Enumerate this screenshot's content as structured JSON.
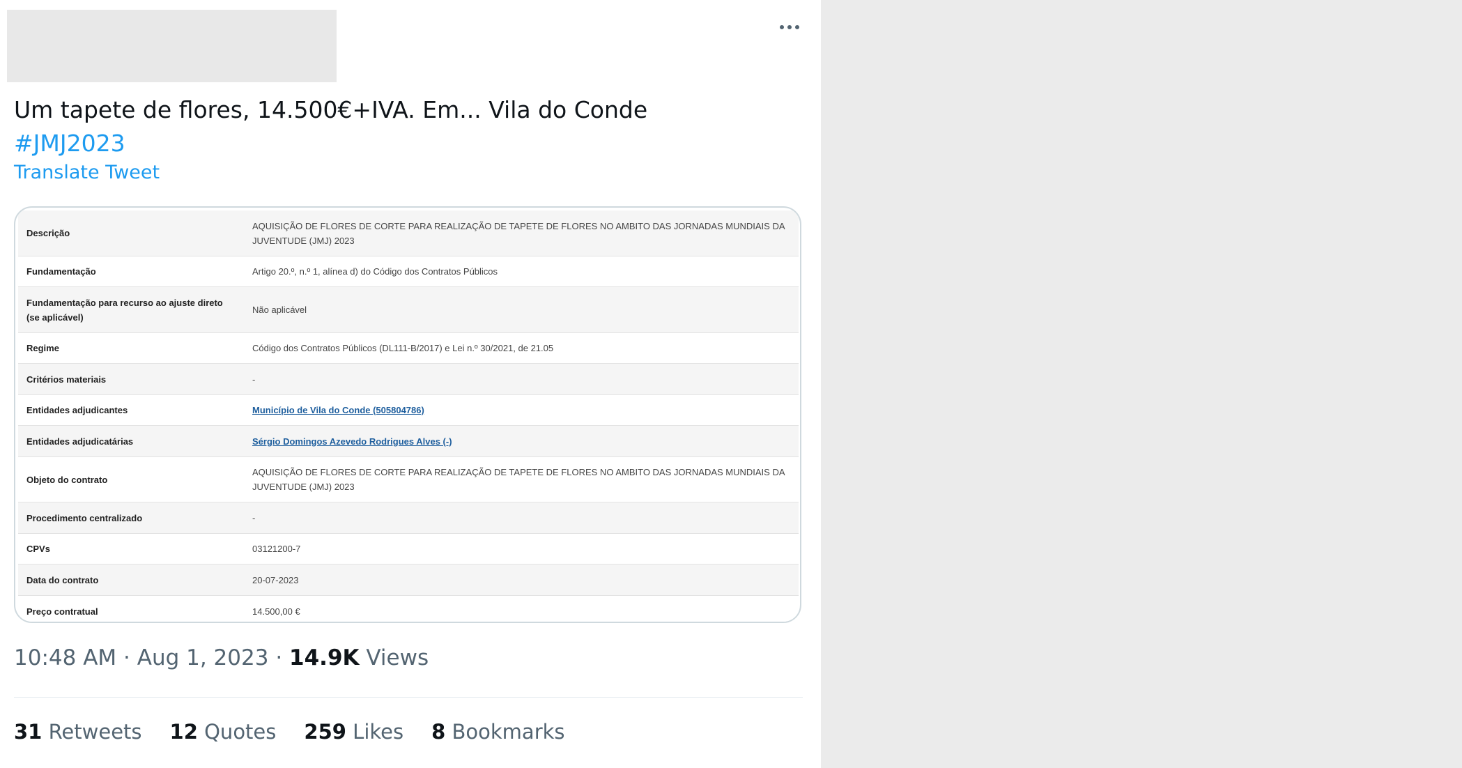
{
  "tweet": {
    "text_line1": "Um tapete de flores, 14.500€+IVA. Em... Vila do Conde",
    "hashtag": "#JMJ2023",
    "translate_label": "Translate Tweet",
    "more_icon": "more-icon"
  },
  "contract": {
    "rows": [
      {
        "label": "Descrição",
        "value": "AQUISIÇÃO DE FLORES DE CORTE PARA REALIZAÇÃO DE TAPETE DE FLORES NO AMBITO DAS JORNADAS MUNDIAIS DA JUVENTUDE (JMJ) 2023"
      },
      {
        "label": "Fundamentação",
        "value": "Artigo 20.º, n.º 1, alínea d) do Código dos Contratos Públicos"
      },
      {
        "label": "Fundamentação para recurso ao ajuste direto (se aplicável)",
        "value": "Não aplicável"
      },
      {
        "label": "Regime",
        "value": "Código dos Contratos Públicos (DL111-B/2017) e Lei n.º 30/2021, de 21.05"
      },
      {
        "label": "Critérios materiais",
        "value": "-"
      },
      {
        "label": "Entidades adjudicantes",
        "value": "Município de Vila do Conde (505804786)"
      },
      {
        "label": "Entidades adjudicatárias",
        "value": "Sérgio Domingos Azevedo Rodrigues Alves (-)"
      },
      {
        "label": "Objeto do contrato",
        "value": "AQUISIÇÃO DE FLORES DE CORTE PARA REALIZAÇÃO DE TAPETE DE FLORES NO AMBITO DAS JORNADAS MUNDIAIS DA JUVENTUDE (JMJ) 2023"
      },
      {
        "label": "Procedimento centralizado",
        "value": "-"
      },
      {
        "label": "CPVs",
        "value": "03121200-7"
      },
      {
        "label": "Data do contrato",
        "value": "20-07-2023"
      },
      {
        "label": "Preço contratual",
        "value": "14.500,00 €"
      }
    ]
  },
  "meta": {
    "time": "10:48 AM",
    "separator": "·",
    "date": "Aug 1, 2023",
    "views_count": "14.9K",
    "views_label": "Views"
  },
  "stats": {
    "retweets_count": "31",
    "retweets_label": "Retweets",
    "quotes_count": "12",
    "quotes_label": "Quotes",
    "likes_count": "259",
    "likes_label": "Likes",
    "bookmarks_count": "8",
    "bookmarks_label": "Bookmarks"
  }
}
